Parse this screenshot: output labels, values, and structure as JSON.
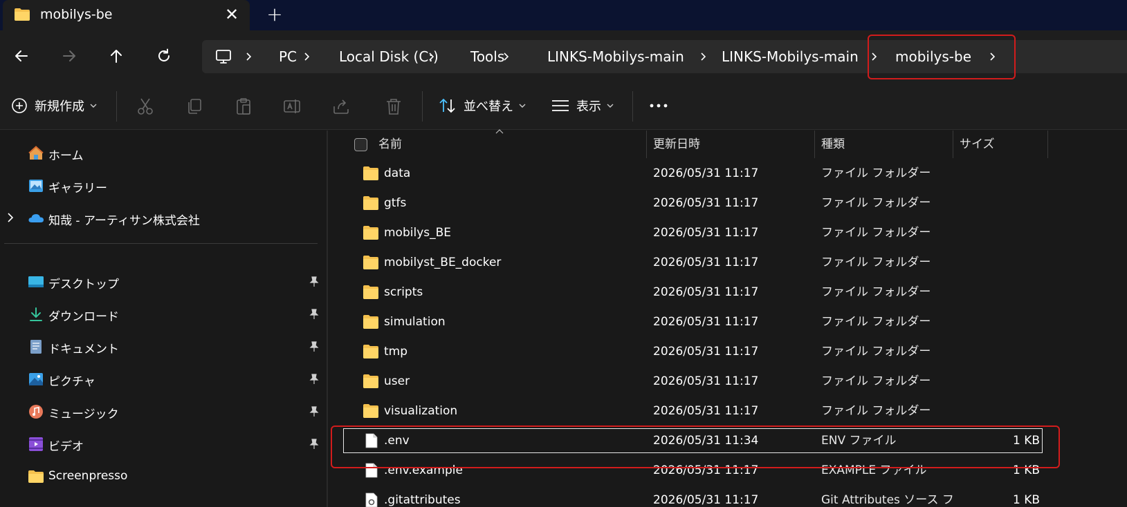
{
  "tab": {
    "title": "mobilys-be",
    "close_glyph": "✕",
    "new_tab_glyph": "+"
  },
  "nav": {
    "back_icon": "arrow-left-icon",
    "forward_icon": "arrow-right-icon",
    "up_icon": "arrow-up-icon",
    "refresh_icon": "refresh-icon"
  },
  "breadcrumb": {
    "items": [
      "PC",
      "Local Disk (C:)",
      "Tools",
      "LINKS-Mobilys-main",
      "LINKS-Mobilys-main",
      "mobilys-be"
    ]
  },
  "commandbar": {
    "new_label": "新規作成",
    "sort_label": "並べ替え",
    "view_label": "表示",
    "more_glyph": "•••"
  },
  "sidebar": {
    "items": [
      {
        "label": "ホーム",
        "icon": "home-icon"
      },
      {
        "label": "ギャラリー",
        "icon": "gallery-icon"
      },
      {
        "label": "知哉 - アーティサン株式会社",
        "icon": "onedrive-cloud-icon"
      }
    ],
    "quick_access": [
      {
        "label": "デスクトップ",
        "icon": "desktop-icon"
      },
      {
        "label": "ダウンロード",
        "icon": "download-icon"
      },
      {
        "label": "ドキュメント",
        "icon": "document-icon"
      },
      {
        "label": "ピクチャ",
        "icon": "pictures-icon"
      },
      {
        "label": "ミュージック",
        "icon": "music-icon"
      },
      {
        "label": "ビデオ",
        "icon": "video-icon"
      },
      {
        "label": "Screenpresso",
        "icon": "folder-icon"
      }
    ]
  },
  "columns": {
    "name": "名前",
    "date": "更新日時",
    "type": "種類",
    "size": "サイズ"
  },
  "files": [
    {
      "name": "data",
      "date": "2026/05/31 11:17",
      "type": "ファイル フォルダー",
      "size": "",
      "kind": "folder"
    },
    {
      "name": "gtfs",
      "date": "2026/05/31 11:17",
      "type": "ファイル フォルダー",
      "size": "",
      "kind": "folder"
    },
    {
      "name": "mobilys_BE",
      "date": "2026/05/31 11:17",
      "type": "ファイル フォルダー",
      "size": "",
      "kind": "folder"
    },
    {
      "name": "mobilyst_BE_docker",
      "date": "2026/05/31 11:17",
      "type": "ファイル フォルダー",
      "size": "",
      "kind": "folder"
    },
    {
      "name": "scripts",
      "date": "2026/05/31 11:17",
      "type": "ファイル フォルダー",
      "size": "",
      "kind": "folder"
    },
    {
      "name": "simulation",
      "date": "2026/05/31 11:17",
      "type": "ファイル フォルダー",
      "size": "",
      "kind": "folder"
    },
    {
      "name": "tmp",
      "date": "2026/05/31 11:17",
      "type": "ファイル フォルダー",
      "size": "",
      "kind": "folder"
    },
    {
      "name": "user",
      "date": "2026/05/31 11:17",
      "type": "ファイル フォルダー",
      "size": "",
      "kind": "folder"
    },
    {
      "name": "visualization",
      "date": "2026/05/31 11:17",
      "type": "ファイル フォルダー",
      "size": "",
      "kind": "folder"
    },
    {
      "name": ".env",
      "date": "2026/05/31 11:34",
      "type": "ENV ファイル",
      "size": "1 KB",
      "kind": "file"
    },
    {
      "name": ".env.example",
      "date": "2026/05/31 11:17",
      "type": "EXAMPLE ファイル",
      "size": "1 KB",
      "kind": "file"
    },
    {
      "name": ".gitattributes",
      "date": "2026/05/31 11:17",
      "type": "Git Attributes ソース フ",
      "size": "1 KB",
      "kind": "gear-file"
    }
  ],
  "colors": {
    "highlight": "#d21c1c",
    "folder": "#f4c04d",
    "accent": "#4cc2ff"
  }
}
